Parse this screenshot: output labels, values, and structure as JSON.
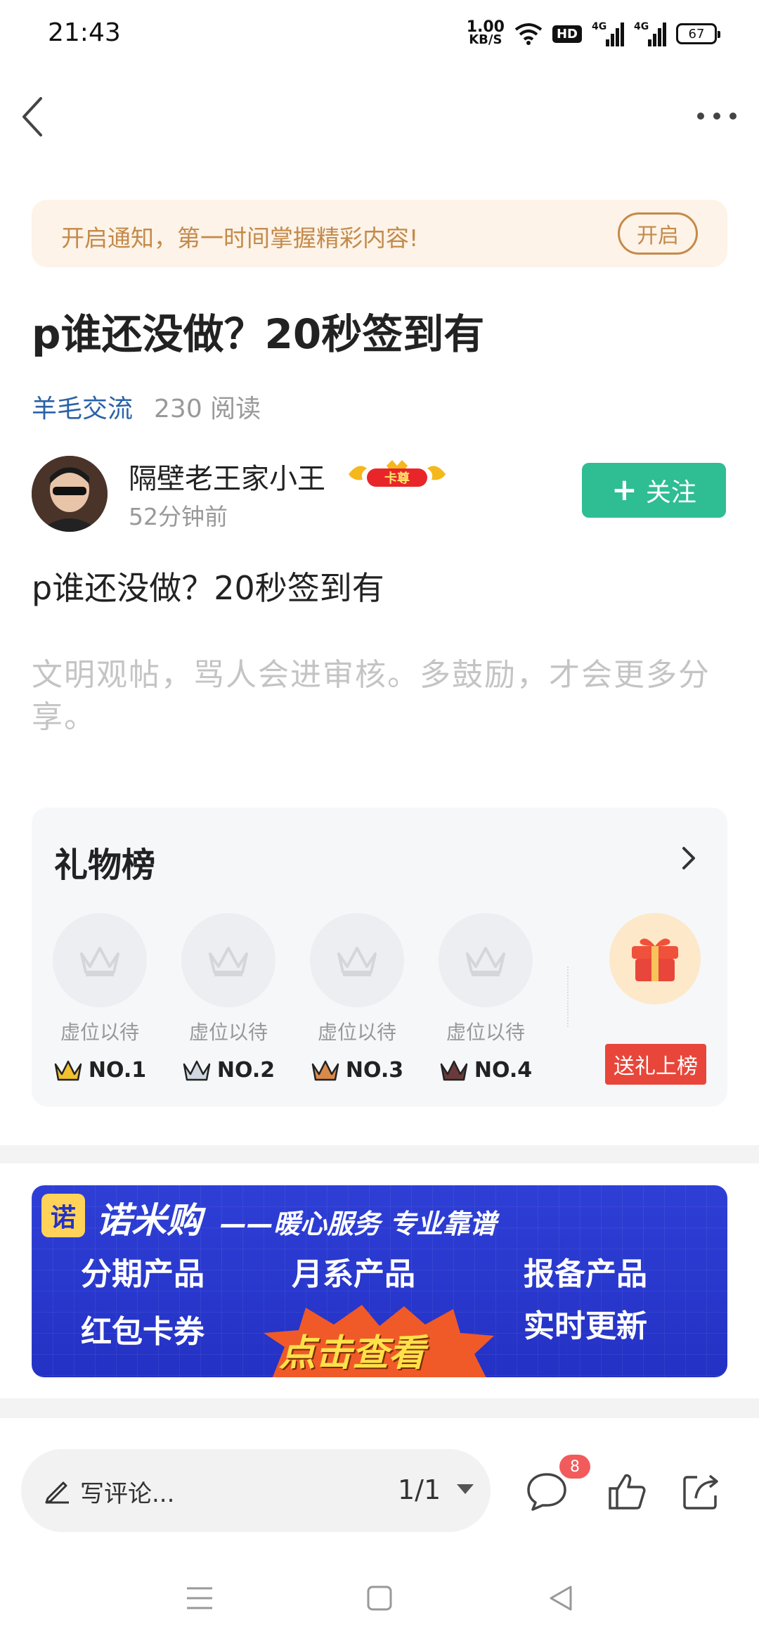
{
  "status_bar": {
    "time": "21:43",
    "net_speed_value": "1.00",
    "net_speed_unit": "KB/S",
    "hd_label": "HD",
    "signal1_tag": "4G",
    "signal2_tag": "4G",
    "battery": "67"
  },
  "notify": {
    "text": "开启通知，第一时间掌握精彩内容!",
    "button": "开启"
  },
  "post": {
    "title": "p谁还没做？20秒签到有",
    "category": "羊毛交流",
    "reads": "230 阅读",
    "body": "p谁还没做？20秒签到有",
    "hint": "文明观帖，骂人会进审核。多鼓励，才会更多分享。"
  },
  "author": {
    "name": "隔壁老王家小王",
    "badge": "卡尊",
    "time": "52分钟前",
    "follow_label": "关注"
  },
  "gift_board": {
    "title": "礼物榜",
    "slots": [
      {
        "label": "虚位以待",
        "rank": "NO.1",
        "crown_color": "#f2c12e"
      },
      {
        "label": "虚位以待",
        "rank": "NO.2",
        "crown_color": "#8a9aa8"
      },
      {
        "label": "虚位以待",
        "rank": "NO.3",
        "crown_color": "#d88a4a"
      },
      {
        "label": "虚位以待",
        "rank": "NO.4",
        "crown_color": "#6a3a3a"
      }
    ],
    "send_button": "送礼上榜"
  },
  "ad": {
    "logo": "诺",
    "brand": "诺米购",
    "slogan": "——暖心服务 专业靠谱",
    "items": [
      "分期产品",
      "月系产品",
      "报备产品",
      "红包卡券",
      "实时更新"
    ],
    "cta": "点击查看"
  },
  "bottom_bar": {
    "comment_placeholder": "写评论...",
    "page": "1/1",
    "comment_count": "8"
  }
}
